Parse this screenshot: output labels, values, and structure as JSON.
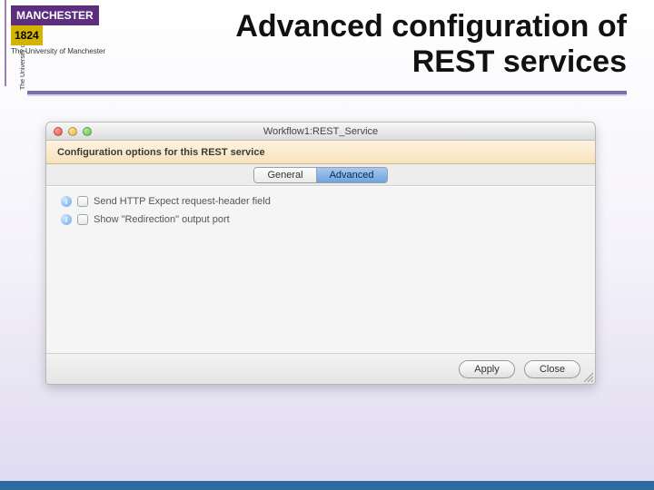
{
  "slide": {
    "logo_name": "MANCHESTER",
    "logo_year": "1824",
    "logo_sub": "The University of Manchester",
    "title": "Advanced configuration of REST services"
  },
  "window": {
    "title": "Workflow1:REST_Service",
    "subheader": "Configuration options for this REST service",
    "tabs": {
      "general": "General",
      "advanced": "Advanced"
    },
    "options": [
      "Send HTTP Expect request-header field",
      "Show \"Redirection\" output port"
    ],
    "buttons": {
      "apply": "Apply",
      "close": "Close"
    }
  }
}
